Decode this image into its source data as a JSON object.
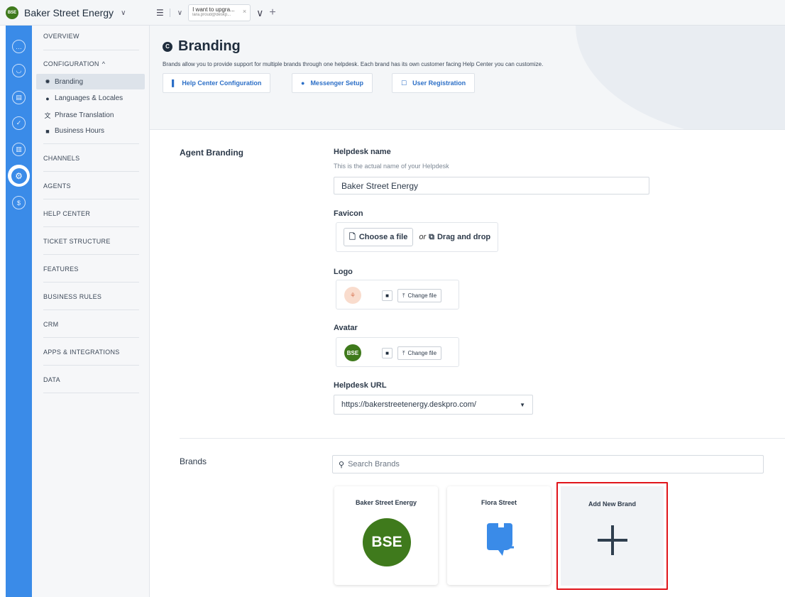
{
  "topbar": {
    "brand_badge": "BSE",
    "brand_name": "Baker Street Energy",
    "brand_chevron": "∨",
    "tab_title": "I want to upgra...",
    "tab_subtitle": "lara.proud@deskp...",
    "tab_close": "×",
    "more_glyph": "∨",
    "add_glyph": "+"
  },
  "rail": {
    "icons": [
      "chat-icon",
      "user-icon",
      "ticket-search-icon",
      "task-check-icon",
      "reports-icon",
      "settings-icon",
      "billing-icon"
    ],
    "active": "settings-icon"
  },
  "sidebar": {
    "overview": "OVERVIEW",
    "configuration": "CONFIGURATION",
    "configuration_caret": "^",
    "items": [
      {
        "label": "Branding",
        "icon": "✹"
      },
      {
        "label": "Languages & Locales",
        "icon": "●"
      },
      {
        "label": "Phrase Translation",
        "icon": "文"
      },
      {
        "label": "Business Hours",
        "icon": "■"
      }
    ],
    "sections": [
      "CHANNELS",
      "AGENTS",
      "HELP CENTER",
      "TICKET STRUCTURE",
      "FEATURES",
      "BUSINESS RULES",
      "CRM",
      "APPS & INTEGRATIONS",
      "DATA"
    ]
  },
  "header": {
    "title_icon": "C",
    "title": "Branding",
    "description": "Brands allow you to provide support for multiple brands through one helpdesk. Each brand has its own customer facing Help Center you can customize.",
    "buttons": [
      {
        "label": "Help Center Configuration",
        "icon": "▌"
      },
      {
        "label": "Messenger Setup",
        "icon": "●"
      },
      {
        "label": "User Registration",
        "icon": "☐"
      }
    ]
  },
  "agent_branding": {
    "section_label": "Agent Branding",
    "helpdesk_name_label": "Helpdesk name",
    "helpdesk_name_help": "This is the actual name of your Helpdesk",
    "helpdesk_name_value": "Baker Street Energy",
    "favicon_label": "Favicon",
    "choose_file": "Choose a file",
    "or": "or",
    "drag_drop": "Drag and drop",
    "logo_label": "Logo",
    "change_file": "Change file",
    "avatar_label": "Avatar",
    "avatar_text": "BSE",
    "helpdesk_url_label": "Helpdesk URL",
    "helpdesk_url_value": "https://bakerstreetenergy.deskpro.com/"
  },
  "brands": {
    "section_label": "Brands",
    "search_placeholder": "Search Brands",
    "cards": [
      {
        "name": "Baker Street Energy",
        "badge": "BSE"
      },
      {
        "name": "Flora Street"
      }
    ],
    "add_new": "Add New Brand"
  },
  "colors": {
    "rail": "#3a8be8",
    "brand_green": "#3f7a1c",
    "link_blue": "#2c6fc7",
    "highlight_red": "#e0141a"
  }
}
